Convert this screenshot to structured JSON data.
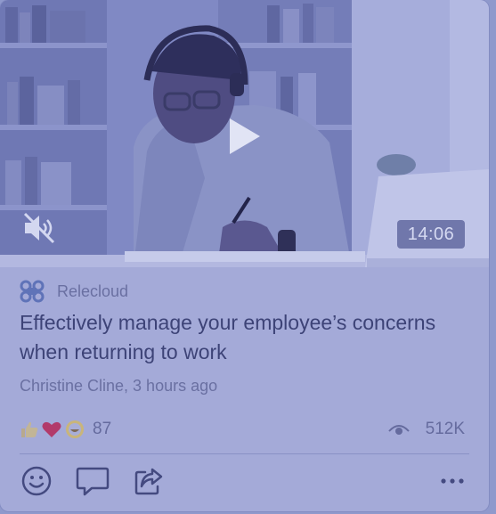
{
  "video": {
    "duration": "14:06",
    "play_icon": "play-icon",
    "mute_icon": "speaker-muted-icon"
  },
  "post": {
    "source": "Relecloud",
    "source_icon": "relecloud-logo-icon",
    "title": "Effectively manage your employee’s concerns when returning to work",
    "byline": "Christine Cline, 3 hours ago"
  },
  "stats": {
    "reaction_icons": [
      "thumbs-up-icon",
      "heart-icon",
      "laugh-icon"
    ],
    "reaction_count": "87",
    "views_icon": "eye-icon",
    "views_count": "512K"
  },
  "actions": {
    "icons": [
      "emoji-react-icon",
      "comment-icon",
      "share-icon",
      "more-icon"
    ]
  },
  "colors": {
    "overlay": "#8f99cc",
    "text_primary": "#3d4377",
    "text_secondary": "#6a70a2"
  }
}
